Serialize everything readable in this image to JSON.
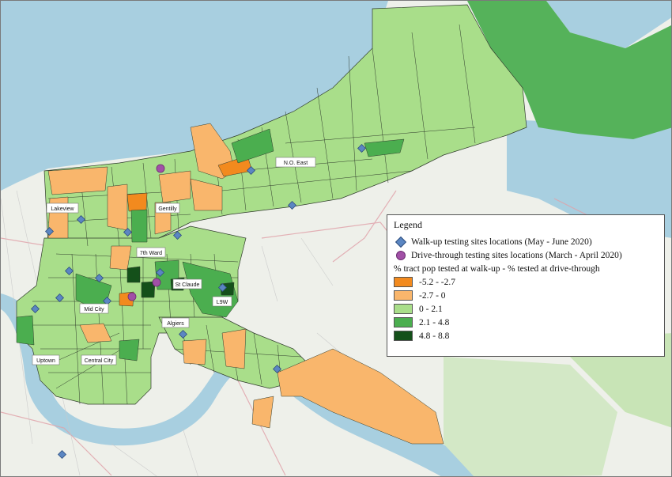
{
  "legend": {
    "title": "Legend",
    "walkup_label": "Walk-up testing sites locations (May - June 2020)",
    "drive_label": "Drive-through testing sites locations (March - April 2020)",
    "subtitle": "% tract pop tested at walk-up - % tested at drive-through",
    "classes": [
      {
        "label": "-5.2 - -2.7",
        "color": "#f28a1e"
      },
      {
        "label": "-2.7 - 0",
        "color": "#f9b66c"
      },
      {
        "label": "0 - 2.1",
        "color": "#a9de8a"
      },
      {
        "label": "2.1 - 4.8",
        "color": "#4bae4f"
      },
      {
        "label": "4.8 - 8.8",
        "color": "#14501a"
      }
    ]
  },
  "place_labels": {
    "no_east": "N.O. East",
    "lakeview": "Lakeview",
    "gentilly": "Gentilly",
    "seventh_ward": "7th Ward",
    "st_claude": "St Claude",
    "lower_nine": "L9W",
    "mid_city": "Mid City",
    "algiers": "Algiers",
    "uptown": "Uptown",
    "central_city": "Central City"
  },
  "map_colors": {
    "water": "#a8cfe0",
    "land": "#eef0ea",
    "wetland": "#8fcc8a",
    "tract_border": "#2f3a2c"
  }
}
